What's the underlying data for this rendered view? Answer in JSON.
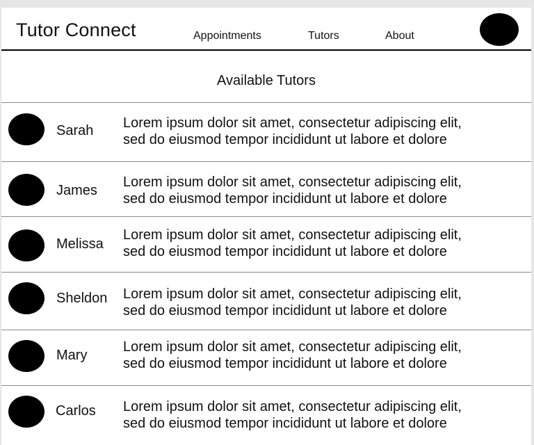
{
  "header": {
    "title": "Tutor Connect",
    "nav": [
      {
        "label": "Appointments"
      },
      {
        "label": "Tutors"
      },
      {
        "label": "About"
      }
    ]
  },
  "main": {
    "section_title": "Available Tutors",
    "tutors": [
      {
        "name": "Sarah",
        "description_line1": "Lorem ipsum dolor sit amet, consectetur adipiscing elit,",
        "description_line2": "sed do eiusmod tempor incididunt ut labore et dolore"
      },
      {
        "name": "James",
        "description_line1": "Lorem ipsum dolor sit amet, consectetur adipiscing elit,",
        "description_line2": "sed do eiusmod tempor incididunt ut labore et dolore"
      },
      {
        "name": "Melissa",
        "description_line1": "Lorem ipsum dolor sit amet, consectetur adipiscing elit,",
        "description_line2": "sed do eiusmod tempor incididunt ut labore et dolore"
      },
      {
        "name": "Sheldon",
        "description_line1": "Lorem ipsum dolor sit amet, consectetur adipiscing elit,",
        "description_line2": "sed do eiusmod tempor incididunt ut labore et dolore"
      },
      {
        "name": "Mary",
        "description_line1": "Lorem ipsum dolor sit amet, consectetur adipiscing elit,",
        "description_line2": "sed do eiusmod tempor incididunt ut labore et dolore"
      },
      {
        "name": "Carlos",
        "description_line1": "Lorem ipsum dolor sit amet, consectetur adipiscing elit,",
        "description_line2": "sed do eiusmod tempor incididunt ut labore et dolore"
      }
    ]
  }
}
